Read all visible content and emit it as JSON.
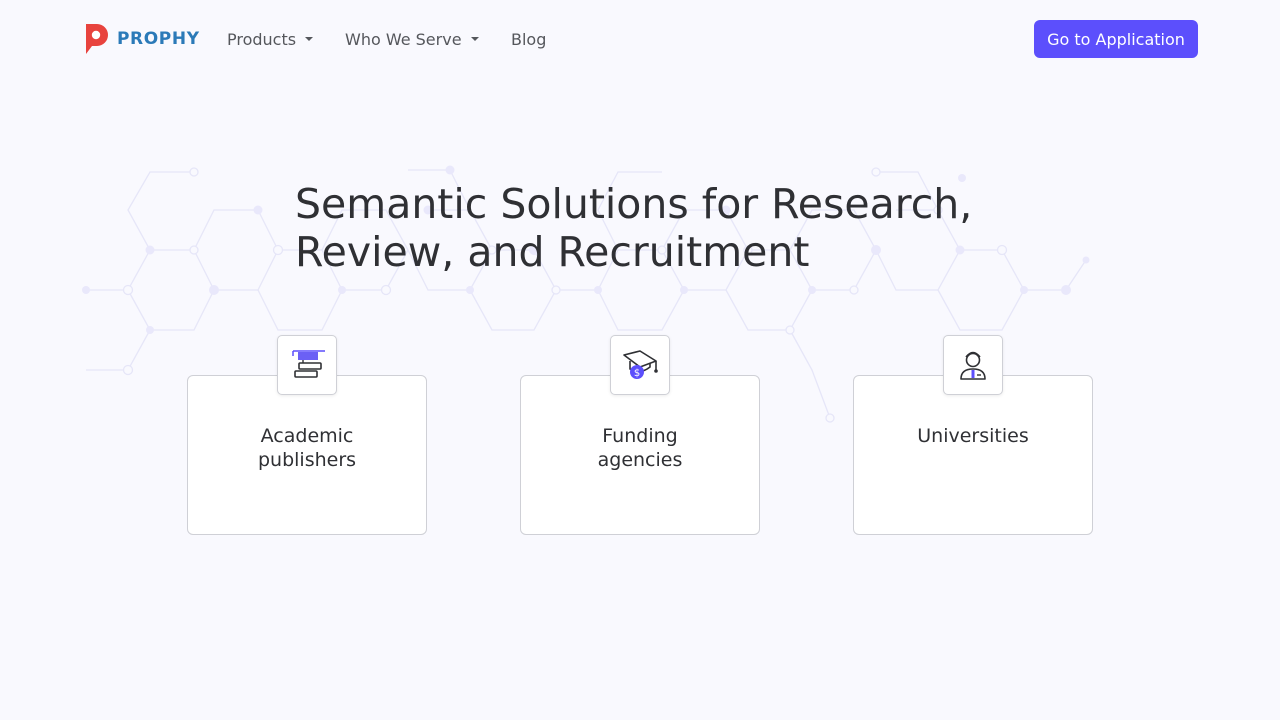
{
  "brand": {
    "name": "PROPHY",
    "logo_color": "#e8433e",
    "text_color": "#2b7ab8"
  },
  "nav": {
    "items": [
      {
        "label": "Products",
        "has_dropdown": true
      },
      {
        "label": "Who We Serve",
        "has_dropdown": true
      },
      {
        "label": "Blog",
        "has_dropdown": false
      }
    ],
    "cta_label": "Go to Application",
    "cta_color": "#5c4ffc"
  },
  "hero": {
    "title_line1": "Semantic Solutions for Research,",
    "title_line2": "Review, and Recruitment"
  },
  "cards": [
    {
      "title_line1": "Academic",
      "title_line2": "publishers",
      "icon": "books-icon"
    },
    {
      "title_line1": "Funding",
      "title_line2": "agencies",
      "icon": "graduation-cap-dollar-icon"
    },
    {
      "title_line1": "Universities",
      "title_line2": "",
      "icon": "student-icon"
    }
  ],
  "colors": {
    "background": "#f9f9fe",
    "accent": "#5c4ffc",
    "text": "#2f3034",
    "card_border": "#cfd0d6"
  }
}
